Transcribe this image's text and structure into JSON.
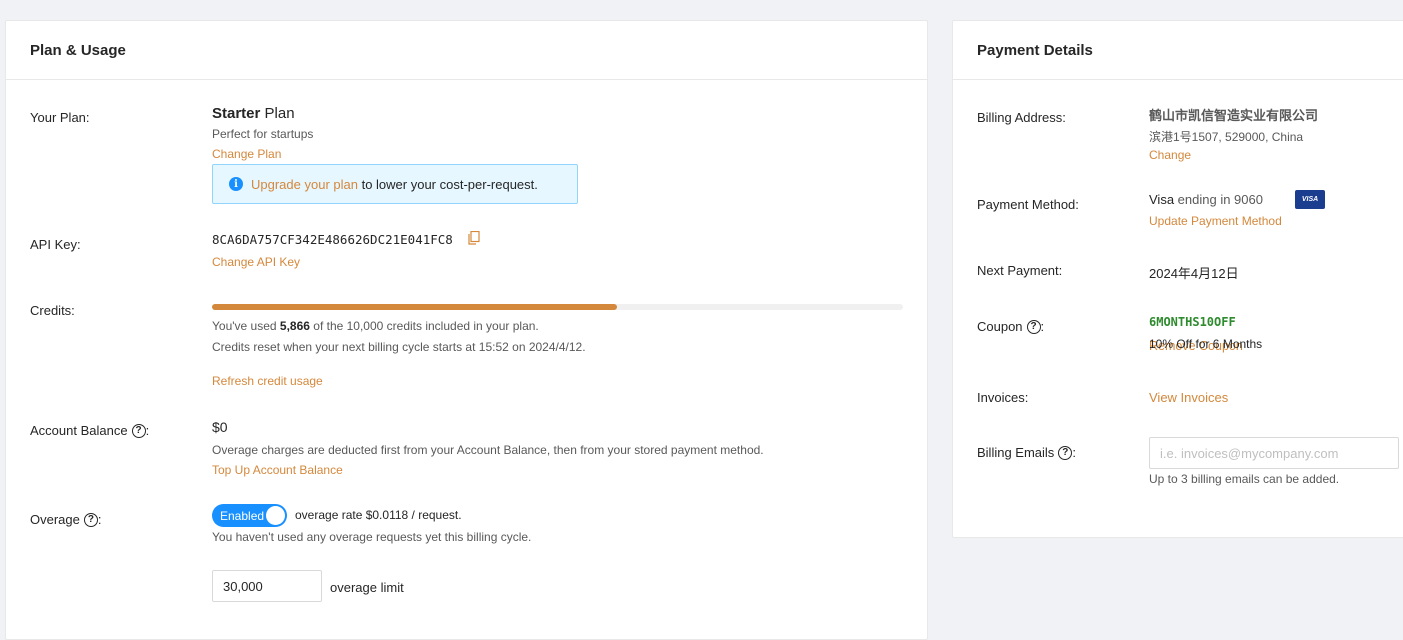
{
  "plan_card": {
    "title": "Plan & Usage",
    "your_plan": {
      "label": "Your Plan:",
      "plan_name_bold": "Starter",
      "plan_name_rest": " Plan",
      "description": "Perfect for startups",
      "change_link": "Change Plan",
      "info_link": "Upgrade your plan",
      "info_text": " to lower your cost-per-request."
    },
    "api_key": {
      "label": "API Key:",
      "value": "8CA6DA757CF342E486626DC21E041FC8",
      "change_link": "Change API Key",
      "copy_icon": "copy-icon"
    },
    "credits": {
      "label": "Credits:",
      "used_fraction": 0.5866,
      "used_prefix": "You've used ",
      "used_value": "5,866",
      "used_suffix": " of the 10,000 credits included in your plan.",
      "reset_text": "Credits reset when your next billing cycle starts at 15:52 on 2024/4/12.",
      "refresh_link": "Refresh credit usage",
      "bar_color": "#d4883c"
    },
    "account_balance": {
      "label": "Account Balance",
      "value": "$0",
      "description": "Overage charges are deducted first from your Account Balance, then from your stored payment method.",
      "top_up_link": "Top Up Account Balance"
    },
    "overage": {
      "label": "Overage",
      "toggle_label": "Enabled",
      "toggle_on": true,
      "rate_text": "overage rate $0.0118 / request.",
      "usage_text": "You haven't used any overage requests yet this billing cycle.",
      "limit_value": "30,000",
      "limit_label": "overage limit"
    }
  },
  "payment_card": {
    "title": "Payment Details",
    "billing_address": {
      "label": "Billing Address:",
      "company": "鹤山市凯信智造实业有限公司",
      "address": "滨港1号1507, 529000, China",
      "change_link": "Change"
    },
    "payment_method": {
      "label": "Payment Method:",
      "card_brand": "Visa",
      "card_text": " ending in 9060",
      "badge": "VISA",
      "update_link": "Update Payment Method"
    },
    "next_payment": {
      "label": "Next Payment:",
      "value": "2024年4月12日"
    },
    "coupon": {
      "label": "Coupon",
      "code": "6MONTHS10OFF",
      "description": "10% Off for 6 Months",
      "remove_link": "Remove Coupon"
    },
    "invoices": {
      "label": "Invoices:",
      "link": "View Invoices"
    },
    "billing_emails": {
      "label": "Billing Emails",
      "placeholder": "i.e. invoices@mycompany.com",
      "help": "Up to 3 billing emails can be added."
    }
  },
  "colors": {
    "accent": "#d4883c",
    "toggle": "#1890ff",
    "info_bg": "#e6f7ff",
    "coupon": "#2e8b2e"
  }
}
